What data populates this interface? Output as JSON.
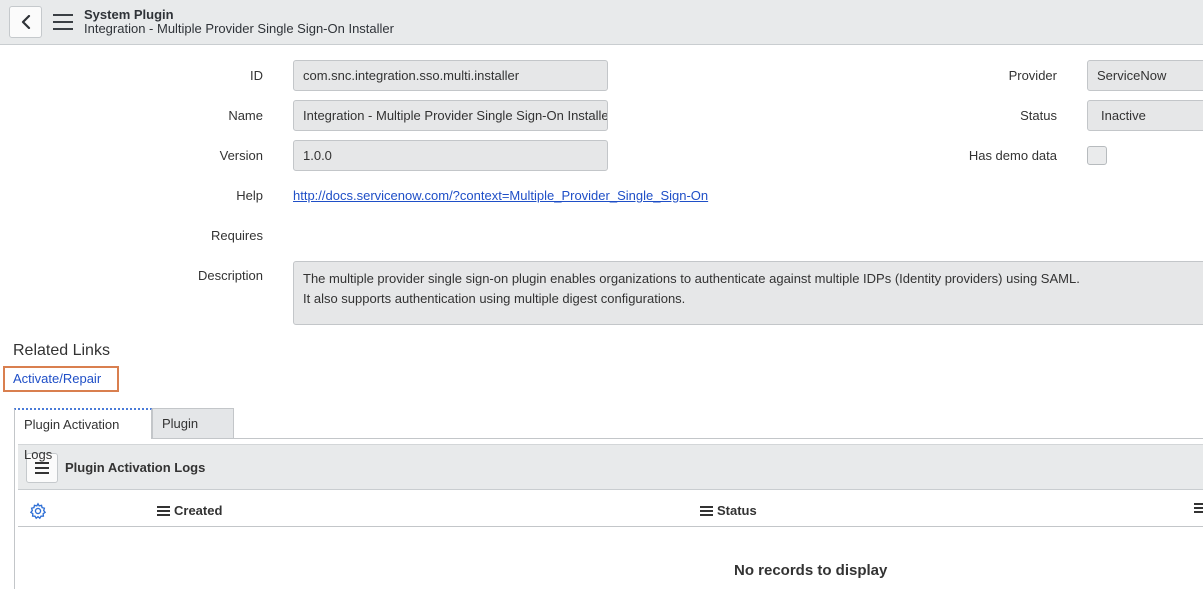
{
  "header": {
    "title": "System Plugin",
    "subtitle": "Integration - Multiple Provider Single Sign-On Installer"
  },
  "form": {
    "id": {
      "label": "ID",
      "value": "com.snc.integration.sso.multi.installer"
    },
    "name": {
      "label": "Name",
      "value": "Integration - Multiple Provider Single Sign-On Installer"
    },
    "version": {
      "label": "Version",
      "value": "1.0.0"
    },
    "help": {
      "label": "Help",
      "value": "http://docs.servicenow.com/?context=Multiple_Provider_Single_Sign-On"
    },
    "requires": {
      "label": "Requires",
      "value": ""
    },
    "description": {
      "label": "Description",
      "line1": "The multiple provider single sign-on plugin enables organizations to authenticate against multiple IDPs (Identity providers) using SAML.",
      "line2": "It also supports authentication using multiple digest configurations."
    },
    "provider": {
      "label": "Provider",
      "value": "ServiceNow"
    },
    "status": {
      "label": "Status",
      "value": "Inactive"
    },
    "has_demo_data": {
      "label": "Has demo data",
      "checked": false
    }
  },
  "related_links": {
    "title": "Related Links",
    "activate_label": "Activate/Repair",
    "highlight_color": "#d97f4f"
  },
  "tabs": [
    {
      "label": "Plugin Activation Logs",
      "active": true
    },
    {
      "label": "Plugin Files",
      "active": false
    }
  ],
  "list": {
    "title": "Plugin Activation Logs",
    "columns": [
      "Created",
      "Status"
    ],
    "empty_message": "No records to display"
  },
  "icons": {
    "back": "chevron-left-icon",
    "menu": "hamburger-menu-icon",
    "settings": "gear-icon"
  },
  "colors": {
    "link": "#1f4fc7",
    "header_bg": "#e8eaeb",
    "field_bg": "#e6e7e8",
    "gear": "#2e6fd6"
  }
}
